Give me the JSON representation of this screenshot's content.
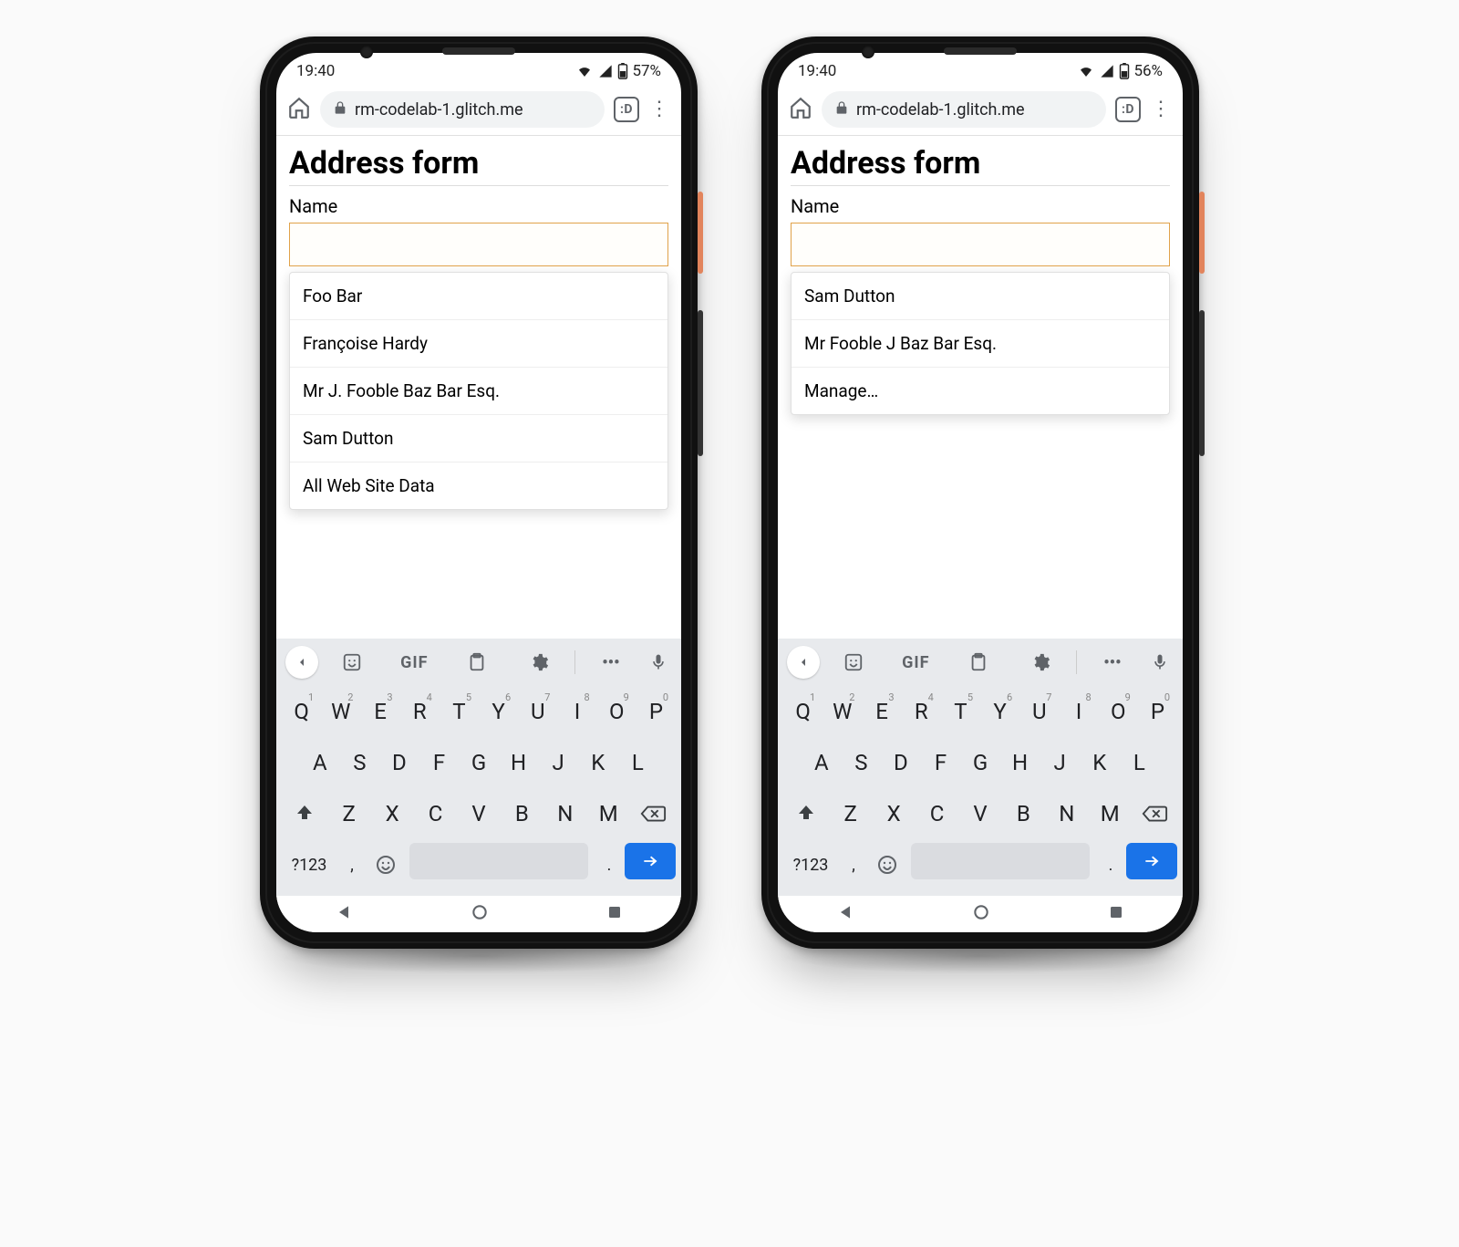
{
  "phones": [
    {
      "status": {
        "time": "19:40",
        "battery": "57%"
      },
      "urlbar": {
        "url": "rm-codelab-1.glitch.me",
        "tab_count": ":D"
      },
      "page": {
        "title": "Address form",
        "name_label": "Name",
        "name_value": "",
        "suggestions": [
          "Foo Bar",
          "Françoise Hardy",
          "Mr J. Fooble Baz Bar Esq.",
          "Sam Dutton",
          "All Web Site Data"
        ]
      }
    },
    {
      "status": {
        "time": "19:40",
        "battery": "56%"
      },
      "urlbar": {
        "url": "rm-codelab-1.glitch.me",
        "tab_count": ":D"
      },
      "page": {
        "title": "Address form",
        "name_label": "Name",
        "name_value": "",
        "suggestions": [
          "Sam Dutton",
          "Mr Fooble J Baz Bar Esq.",
          "Manage…"
        ]
      }
    }
  ],
  "keyboard": {
    "row1": [
      "Q",
      "W",
      "E",
      "R",
      "T",
      "Y",
      "U",
      "I",
      "O",
      "P"
    ],
    "row1_sup": [
      "1",
      "2",
      "3",
      "4",
      "5",
      "6",
      "7",
      "8",
      "9",
      "0"
    ],
    "row2": [
      "A",
      "S",
      "D",
      "F",
      "G",
      "H",
      "J",
      "K",
      "L"
    ],
    "row3": [
      "Z",
      "X",
      "C",
      "V",
      "B",
      "N",
      "M"
    ],
    "numkey": "?123",
    "comma": ",",
    "period": ".",
    "gif_label": "GIF",
    "dots_label": "•••"
  }
}
